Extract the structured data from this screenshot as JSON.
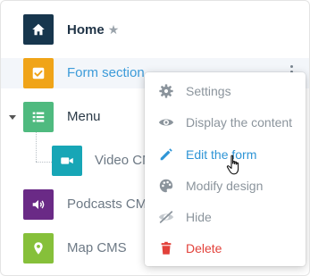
{
  "colors": {
    "home": "#17364d",
    "form_section": "#f0a418",
    "menu": "#4fba7f",
    "video": "#17a6b6",
    "podcasts": "#6a2a86",
    "map": "#86c03a",
    "accent": "#3c9bd9",
    "danger": "#e2413a"
  },
  "tree": {
    "home": {
      "label": "Home",
      "icon": "home-icon",
      "star": "★"
    },
    "form_section": {
      "label": "Form section",
      "icon": "checkbox-icon"
    },
    "menu": {
      "label": "Menu",
      "icon": "list-icon"
    },
    "video": {
      "label": "Video CMS",
      "icon": "video-camera-icon"
    },
    "podcasts": {
      "label": "Podcasts CMS",
      "icon": "speaker-icon"
    },
    "map": {
      "label": "Map CMS",
      "icon": "map-pin-icon"
    }
  },
  "context_menu": {
    "items": [
      {
        "label": "Settings",
        "icon": "gear-icon"
      },
      {
        "label": "Display the content",
        "icon": "eye-icon"
      },
      {
        "label": "Edit the form",
        "icon": "pencil-icon"
      },
      {
        "label": "Modify design",
        "icon": "palette-icon"
      },
      {
        "label": "Hide",
        "icon": "eye-slash-icon"
      },
      {
        "label": "Delete",
        "icon": "trash-icon"
      }
    ]
  }
}
